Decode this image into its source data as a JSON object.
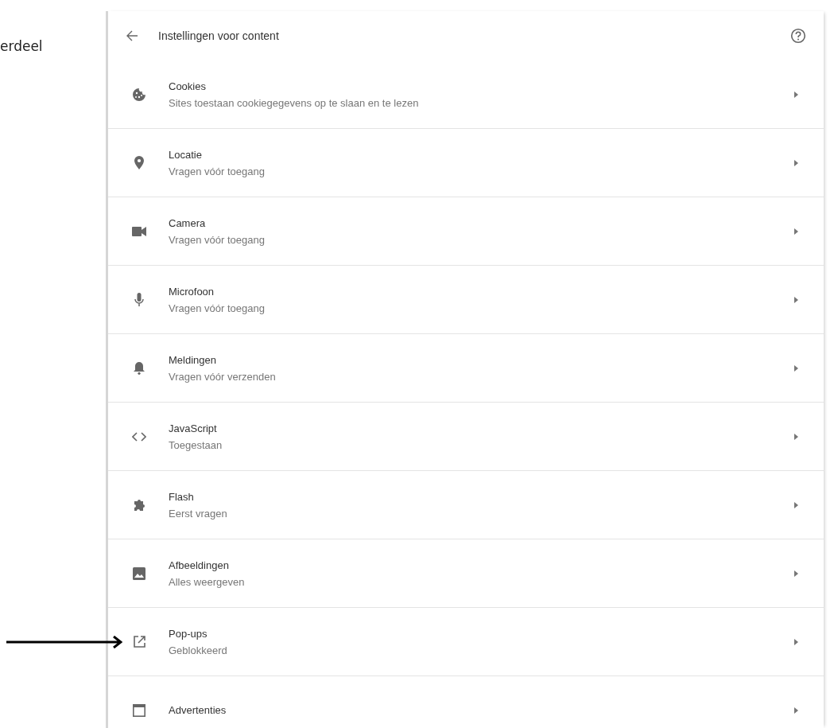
{
  "margin_text": "erdeel",
  "header": {
    "title": "Instellingen voor content"
  },
  "rows": [
    {
      "kind": "cookie",
      "title": "Cookies",
      "subtitle": "Sites toestaan cookiegegevens op te slaan en te lezen"
    },
    {
      "kind": "location",
      "title": "Locatie",
      "subtitle": "Vragen vóór toegang"
    },
    {
      "kind": "camera",
      "title": "Camera",
      "subtitle": "Vragen vóór toegang"
    },
    {
      "kind": "microphone",
      "title": "Microfoon",
      "subtitle": "Vragen vóór toegang"
    },
    {
      "kind": "bell",
      "title": "Meldingen",
      "subtitle": "Vragen vóór verzenden"
    },
    {
      "kind": "code",
      "title": "JavaScript",
      "subtitle": "Toegestaan"
    },
    {
      "kind": "puzzle",
      "title": "Flash",
      "subtitle": "Eerst vragen"
    },
    {
      "kind": "image",
      "title": "Afbeeldingen",
      "subtitle": "Alles weergeven"
    },
    {
      "kind": "popup",
      "title": "Pop-ups",
      "subtitle": "Geblokkeerd",
      "pointed": true
    },
    {
      "kind": "ad",
      "title": "Advertenties"
    }
  ]
}
